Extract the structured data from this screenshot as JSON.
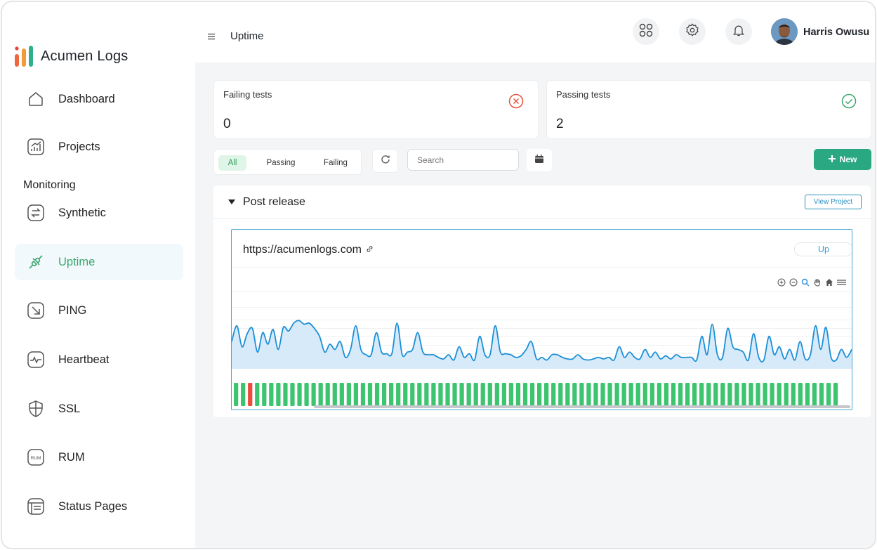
{
  "app": {
    "name": "Acumen Logs"
  },
  "sidebar": {
    "section_monitoring": "Monitoring",
    "items": [
      {
        "label": "Dashboard",
        "icon": "home-icon"
      },
      {
        "label": "Projects",
        "icon": "chart-icon"
      },
      {
        "label": "Synthetic",
        "icon": "swap-icon"
      },
      {
        "label": "Uptime",
        "icon": "plug-icon",
        "active": true
      },
      {
        "label": "PING",
        "icon": "arrow-down-right-icon"
      },
      {
        "label": "Heartbeat",
        "icon": "pulse-icon"
      },
      {
        "label": "SSL",
        "icon": "shield-icon"
      },
      {
        "label": "RUM",
        "icon": "rum-icon"
      },
      {
        "label": "Status Pages",
        "icon": "browser-icon"
      }
    ]
  },
  "header": {
    "title": "Uptime",
    "user_name": "Harris Owusu"
  },
  "stats": {
    "failing": {
      "title": "Failing tests",
      "value": "0",
      "color": "#e5533d"
    },
    "passing": {
      "title": "Passing tests",
      "value": "2",
      "color": "#3aa76d"
    }
  },
  "filters": {
    "options": [
      "All",
      "Passing",
      "Failing"
    ],
    "selected": "All",
    "search_placeholder": "Search",
    "new_label": "New"
  },
  "project": {
    "name": "Post release",
    "view_label": "View Project",
    "monitor": {
      "url": "https://acumenlogs.com",
      "status": "Up"
    }
  },
  "chart_data": {
    "type": "area",
    "series": [
      {
        "values": [
          0.45,
          0.75,
          0.35,
          0.6,
          0.7,
          0.25,
          0.62,
          0.4,
          0.68,
          0.3,
          0.72,
          0.65,
          0.8,
          0.85,
          0.78,
          0.8,
          0.7,
          0.55,
          0.25,
          0.4,
          0.3,
          0.45,
          0.15,
          0.3,
          0.75,
          0.3,
          0.2,
          0.2,
          0.62,
          0.25,
          0.22,
          0.22,
          0.8,
          0.2,
          0.25,
          0.3,
          0.62,
          0.25,
          0.2,
          0.2,
          0.15,
          0.12,
          0.2,
          0.1,
          0.35,
          0.15,
          0.22,
          0.1,
          0.55,
          0.2,
          0.2,
          0.75,
          0.25,
          0.22,
          0.2,
          0.15,
          0.18,
          0.3,
          0.45,
          0.12,
          0.15,
          0.1,
          0.2,
          0.2,
          0.15,
          0.12,
          0.12,
          0.2,
          0.12,
          0.1,
          0.12,
          0.15,
          0.12,
          0.15,
          0.1,
          0.35,
          0.15,
          0.25,
          0.15,
          0.12,
          0.3,
          0.15,
          0.25,
          0.12,
          0.18,
          0.12,
          0.2,
          0.15,
          0.15,
          0.15,
          0.1,
          0.55,
          0.2,
          0.78,
          0.2,
          0.15,
          0.7,
          0.35,
          0.3,
          0.25,
          0.1,
          0.6,
          0.15,
          0.1,
          0.55,
          0.2,
          0.35,
          0.12,
          0.3,
          0.1,
          0.45,
          0.12,
          0.2,
          0.75,
          0.3,
          0.72,
          0.15,
          0.1,
          0.3,
          0.15,
          0.3
        ]
      }
    ],
    "status_bars": {
      "count": 86,
      "down_indices": [
        2
      ],
      "up_color": "#3cc46e",
      "down_color": "#ef4b3b"
    },
    "line_color": "#1b8fd6",
    "fill_color": "#d6eafa"
  },
  "colors": {
    "accent": "#2aa882",
    "active_nav": "#3aa76d"
  }
}
